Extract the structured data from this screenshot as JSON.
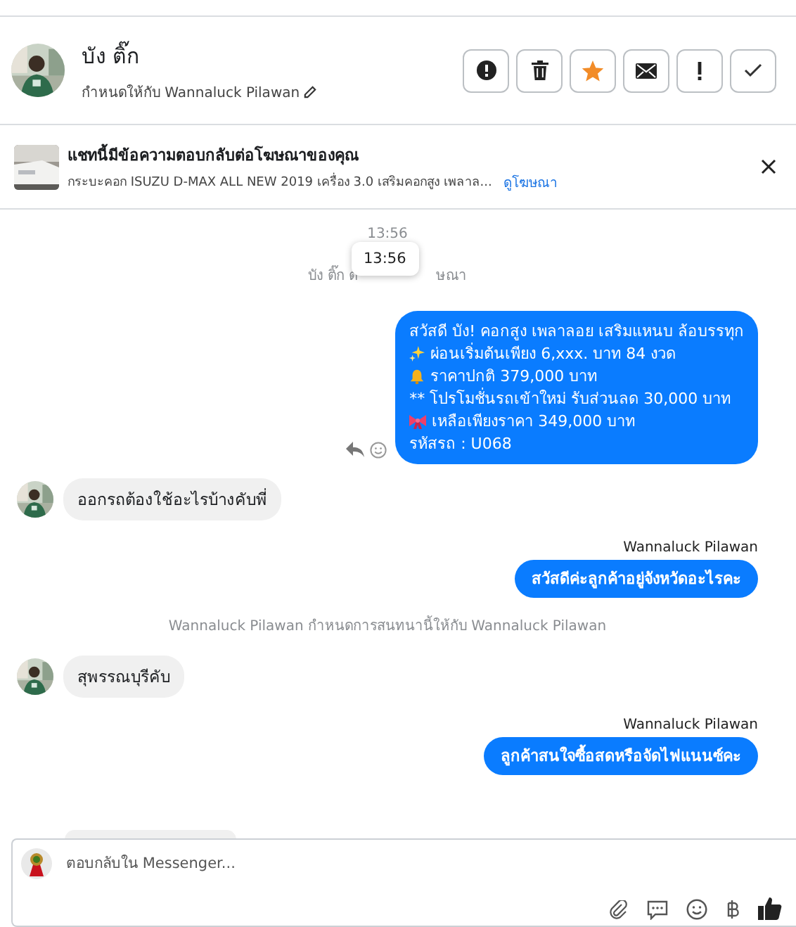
{
  "contact": {
    "name": "บัง ติ๊ก",
    "assigned": "กำหนดให้กับ Wannaluck Pilawan"
  },
  "actions": [
    {
      "kind": "spam"
    },
    {
      "kind": "delete"
    },
    {
      "kind": "star",
      "on": true
    },
    {
      "kind": "unread"
    },
    {
      "kind": "important"
    },
    {
      "kind": "done"
    }
  ],
  "ad_banner": {
    "title": "แชทนี้มีข้อความตอบกลับต่อโฆษณาของคุณ",
    "subtitle": "กระบะคอก ISUZU D-MAX ALL NEW 2019 เครื่อง 3.0 เสริมคอกสูง เพลาล...",
    "link": "ดูโฆษณา"
  },
  "messages": [
    {
      "kind": "time",
      "text": "13:56"
    },
    {
      "kind": "note_covered",
      "before": "บัง ติ๊ก ต",
      "after": "ษณา",
      "tooltip": "13:56"
    },
    {
      "kind": "outgoing",
      "lines": [
        {
          "kind": "plain",
          "text": "สวัสดี บัง! คอกสูง เพลาลอย เสริมแหนบ ล้อบรรทุก"
        },
        {
          "kind": "sparkles",
          "text": "ผ่อนเริ่มต้นเพียง 6,xxx. บาท 84 งวด"
        },
        {
          "kind": "bell",
          "text": "ราคาปกติ 379,000 บาท"
        },
        {
          "kind": "plain",
          "text": "** โปรโมชั่นรถเข้าใหม่ รับส่วนลด 30,000 บาท"
        },
        {
          "kind": "ribbon",
          "text": "เหลือเพียงราคา 349,000 บาท"
        },
        {
          "kind": "plain",
          "text": "รหัสรถ : U068"
        }
      ],
      "hovered": true
    },
    {
      "kind": "incoming",
      "text": "ออกรถต้องใช้อะไรบ้างคับพี่"
    },
    {
      "kind": "outgoing",
      "sender": "Wannaluck Pilawan",
      "lines": [
        {
          "kind": "plain",
          "text": "สวัสดีค่ะลูกค้าอยู่จังหวัดอะไรคะ"
        }
      ],
      "hovered": false
    },
    {
      "kind": "note",
      "text": "Wannaluck Pilawan กำหนดการสนทนานี้ให้กับ Wannaluck Pilawan"
    },
    {
      "kind": "incoming",
      "text": "สุพรรณบุรีคับ"
    },
    {
      "kind": "outgoing",
      "sender": "Wannaluck Pilawan",
      "lines": [
        {
          "kind": "plain",
          "text": "ลูกค้าสนใจซื้อสดหรือจัดไฟแนนซ์คะ"
        }
      ],
      "hovered": false
    }
  ],
  "composer": {
    "placeholder": "ตอบกลับใน Messenger..."
  }
}
